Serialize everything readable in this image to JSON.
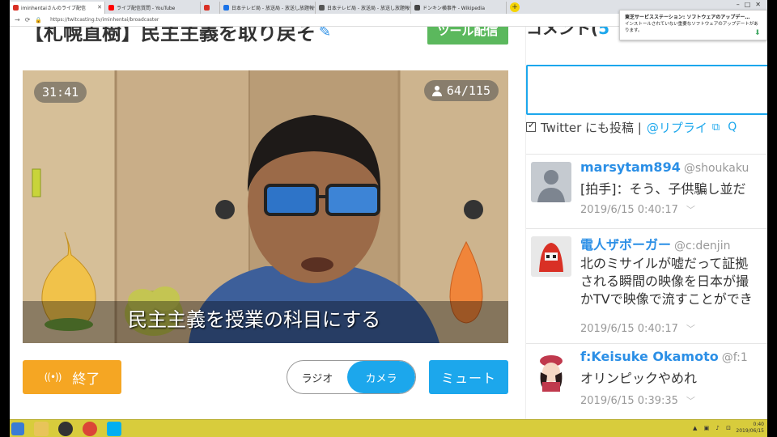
{
  "browser": {
    "tabs": [
      {
        "label": "iminhentaiさんのライブ配信",
        "color": "#d93025",
        "active": true
      },
      {
        "label": "ライブ配信質問 - YouTube",
        "color": "#ff0000",
        "active": false
      },
      {
        "label": "",
        "color": "#d93025",
        "active": false
      },
      {
        "label": "日本テレビ局 - 放送局 - 放送し放題報告",
        "color": "#1a73e8",
        "active": false
      },
      {
        "label": "日本テレビ局 - 放送局 - 放送し放題報告",
        "color": "#555555",
        "active": false
      },
      {
        "label": "ドンキン横事件 - Wikipedia",
        "color": "#444444",
        "active": false
      }
    ],
    "url": "https://twitcasting.tv/iminhentai/broadcaster"
  },
  "notification": {
    "title": "東芝サービスステーション: ソフトウェアのアップデー…",
    "body": "インストールされていない重要なソフトウェアのアップデートがあります。"
  },
  "header": {
    "title": "【札幌直樹】民主主義を取り戻そ",
    "tool_label": "ツール配信"
  },
  "video": {
    "timer": "31:41",
    "viewers": "64/115",
    "caption": "民主主義を授業の科目にする"
  },
  "controls": {
    "end_label": "終了",
    "broadcast_icon": "((•))",
    "mode_radio": "ラジオ",
    "mode_camera": "カメラ",
    "mute_label": "ミュート"
  },
  "comments_panel": {
    "heading": "コメント(",
    "heading_accent": "5",
    "twitter_label": "Twitter にも投稿 |",
    "reply_label": "@リプライ",
    "items": [
      {
        "name": "marsytam894",
        "handle": "@shoukaku",
        "text": "[拍手]：そう、子供騙し並だ",
        "time": "2019/6/15 0:40:17"
      },
      {
        "name": "電人ザボーガー",
        "handle": "@c:denjin",
        "text": "北のミサイルが嘘だって証拠\nされる瞬間の映像を日本が撮\nかTVで映像で流すことができ",
        "time": "2019/6/15 0:40:17"
      },
      {
        "name": "f:Keisuke Okamoto",
        "handle": "@f:1",
        "text": "オリンピックやめれ",
        "time": "2019/6/15 0:39:35"
      }
    ]
  },
  "taskbar": {
    "time": "0:40",
    "date": "2019/06/15"
  },
  "colors": {
    "accent_blue": "#1ca7ec",
    "end_orange": "#f5a623",
    "tool_green": "#5bb85d",
    "taskbar": "#d8cc3c"
  }
}
